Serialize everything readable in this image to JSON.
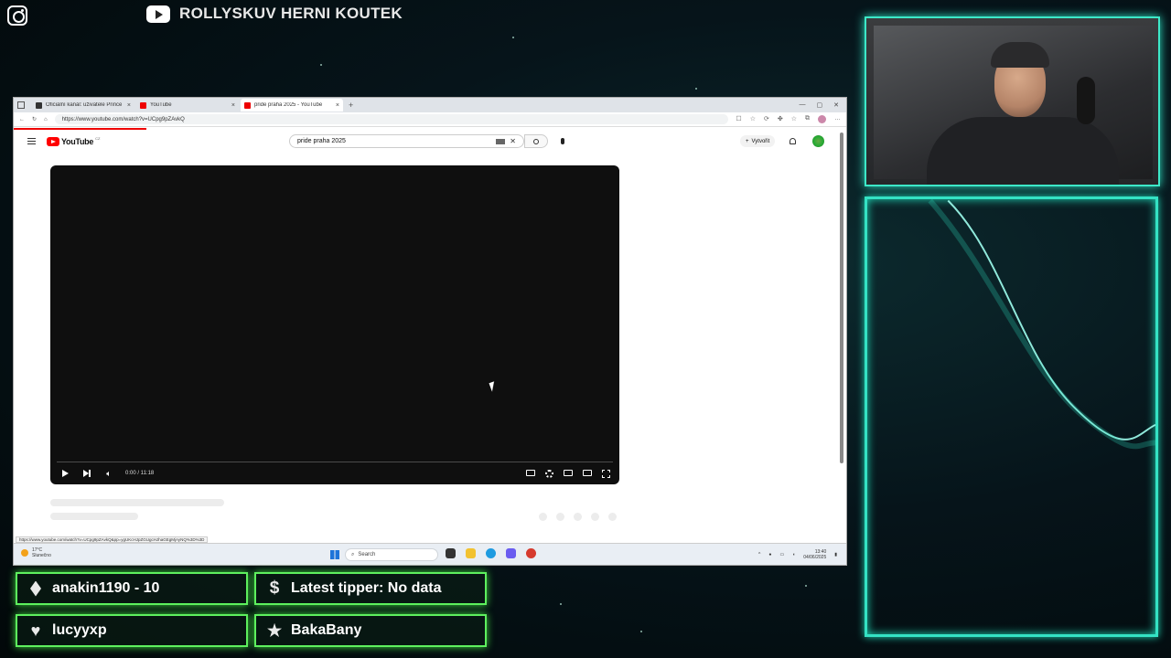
{
  "overlay": {
    "channel_title": "ROLLYSKUV HERNI KOUTEK"
  },
  "browser": {
    "tabs": [
      {
        "label": "Oficiální kanál: uživatele Prince CC"
      },
      {
        "label": "YouTube"
      },
      {
        "label": "pride praha 2025 - YouTube"
      }
    ],
    "url": "https://www.youtube.com/watch?v=UCpg9pZAvkQ",
    "status_url": "https://www.youtube.com/watch?v=UCpg9pZAvkQ&pp=ygUKcHJpZGUgcHJhaGEgMjAyNQ%3D%3D"
  },
  "youtube": {
    "logo_text": "YouTube",
    "logo_region": "CZ",
    "search_value": "pride praha 2025",
    "create_label": "Vytvořit",
    "player": {
      "time": "0:00 / 11:18",
      "progress": 0
    }
  },
  "taskbar": {
    "weather_temp": "17°C",
    "weather_desc": "Slunečno",
    "search_placeholder": "Search",
    "clock_time": "13:40",
    "clock_date": "04/06/2025"
  },
  "stats": {
    "top_donor": "anakin1190 - 10",
    "latest_tipper": "Latest tipper: No data",
    "latest_follower": "lucyyxp",
    "latest_sub": "BakaBany"
  },
  "colors": {
    "accent_green": "#5ef05e",
    "accent_teal": "#34e2c4",
    "youtube_red": "#ff0000"
  }
}
